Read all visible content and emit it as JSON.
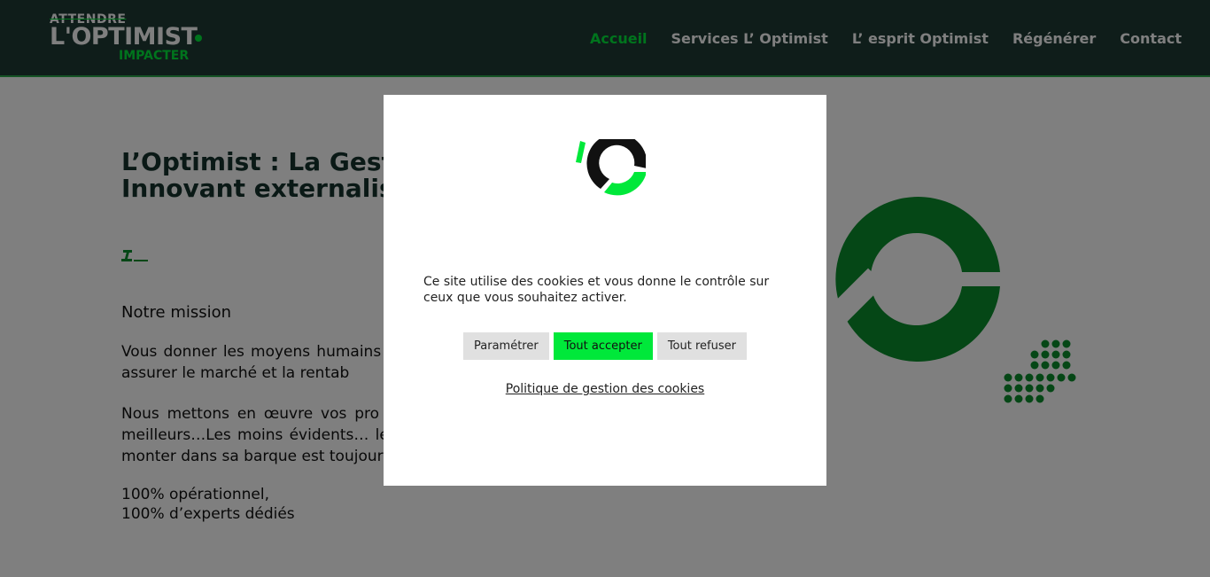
{
  "header": {
    "logo": {
      "top": "ATTENDRE",
      "main": "L'OPTIMIST",
      "bottom": "IMPACTER"
    },
    "nav": [
      {
        "label": "Accueil",
        "active": true
      },
      {
        "label": "Services L’ Optimist"
      },
      {
        "label": "L’ esprit Optimist"
      },
      {
        "label": "Régénérer"
      },
      {
        "label": "Contact"
      }
    ]
  },
  "main": {
    "title_line1": "L’Optimist : La Gesti",
    "title_line2": "Innovant externalis",
    "mission_heading": "Notre mission",
    "para1": "Vous donner les moyens humains les risques d’échecs, vous appor vous assurer le marché et la rentab",
    "para2_highlight": "Nous mettons en œuvre vos pro",
    "para2_rest": " entrepreneurs de notre écosystèn les meilleurs…Les moins évidents… les très sérieux…L’équipe qui vous fera monter dans sa barque est toujours différente et sur mesure.",
    "list": [
      "100% opérationnel,",
      "100% d’experts dédiés"
    ]
  },
  "cookie_modal": {
    "text": "Ce site utilise des cookies et vous donne le contrôle sur ceux que vous souhaitez activer.",
    "buttons": {
      "settings": "Paramétrer",
      "accept_all": "Tout accepter",
      "refuse_all": "Tout refuser"
    },
    "policy_link": "Politique de gestion des cookies"
  },
  "colors": {
    "header_bg": "#1e3a35",
    "accent": "#00e83a",
    "deco_green": "#0a8f2c"
  },
  "icons": {
    "logo_mark": "optimist-ring-icon"
  }
}
